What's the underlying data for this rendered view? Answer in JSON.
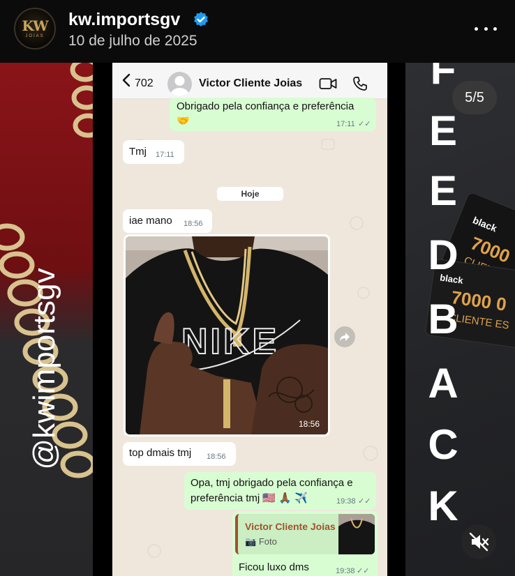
{
  "header": {
    "avatar_logo": "KW",
    "avatar_sub": "JOIAS",
    "username": "kw.importsgv",
    "date": "10 de julho de 2025",
    "verified_icon": "verified-badge-icon",
    "more_icon": "more-options-icon"
  },
  "story": {
    "watermark": "@kwimportsgv",
    "pager": "5/5",
    "overlay_letters": [
      "F",
      "E",
      "E",
      "D",
      "B",
      "A",
      "C",
      "K"
    ],
    "card_texts": [
      "black",
      "7000",
      "CLIENTE ES",
      "7000 0",
      "CLIENTE ES"
    ]
  },
  "chat": {
    "back_count": "702",
    "contact_name": "Victor Cliente Joias",
    "day_label": "Hoje",
    "messages": [
      {
        "text": "Obrigado pela confiança e preferência",
        "emoji": "🤝",
        "time": "17:11"
      },
      {
        "text": "Tmj",
        "time": "17:11"
      },
      {
        "text": "iae mano",
        "time": "18:56"
      },
      {
        "photo_time": "18:56"
      },
      {
        "text": "top dmais tmj",
        "time": "18:56"
      },
      {
        "text_line1": "Opa, tmj obrigado pela confiança e",
        "text_line2": "preferência tmj 🇺🇸 🙏🏾 ✈️",
        "time": "19:38"
      },
      {
        "quote_name": "Victor Cliente Joias",
        "quote_label": "Foto",
        "text": "Ficou luxo dms",
        "time": "19:38"
      }
    ]
  }
}
